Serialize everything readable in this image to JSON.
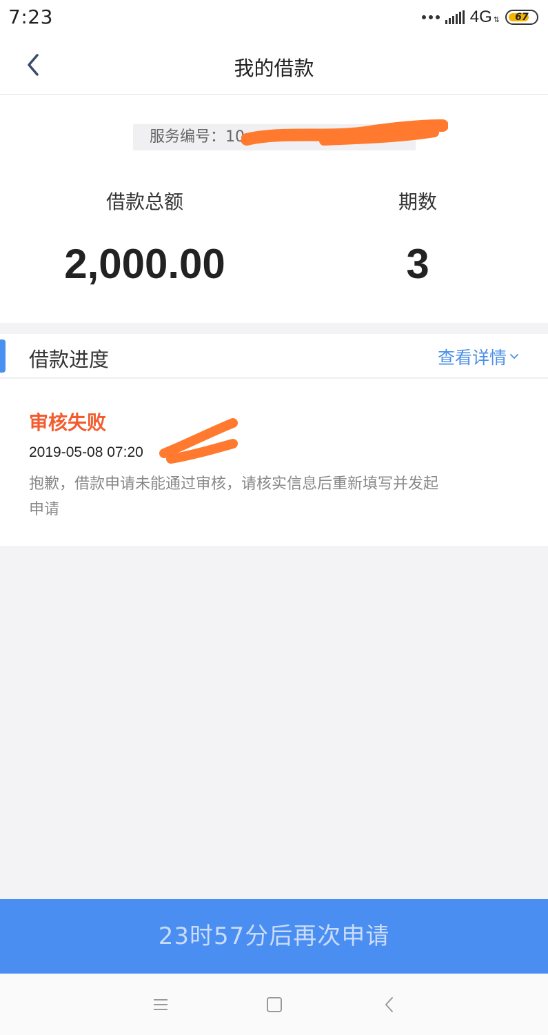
{
  "status_bar": {
    "time": "7:23",
    "network": "4G",
    "battery": "67",
    "icons": [
      "more-dots-icon",
      "signal-icon",
      "battery-icon"
    ]
  },
  "nav": {
    "title": "我的借款",
    "back_icon": "chevron-left-icon"
  },
  "summary": {
    "service_no_label": "服务编号：10",
    "total_label": "借款总额",
    "total_value": "2,000.00",
    "periods_label": "期数",
    "periods_value": "3"
  },
  "progress": {
    "title": "借款进度",
    "detail_link": "查看详情",
    "status": "审核失败",
    "timestamp": "2019-05-08 07:20",
    "description": "抱歉，借款申请未能通过审核，请核实信息后重新填写并发起申请"
  },
  "apply_button": {
    "label": "23时57分后再次申请"
  },
  "colors": {
    "accent": "#4a8ef2",
    "link": "#4a8fe8",
    "error": "#f25c2e",
    "redaction": "#ff7a2e"
  }
}
